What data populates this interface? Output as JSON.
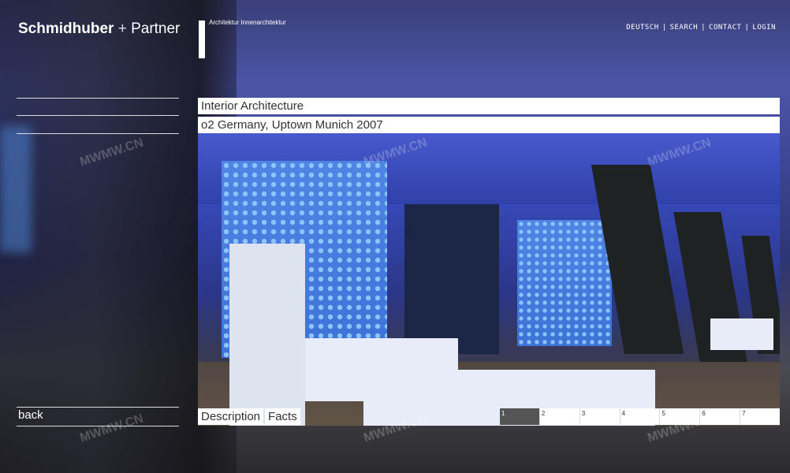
{
  "header": {
    "logo_main": "Schmidhuber",
    "logo_plus": "+",
    "logo_partner": "Partner",
    "tagline": "Architektur  Innenarchitektur",
    "nav": [
      "DEUTSCH",
      "SEARCH",
      "CONTACT",
      "LOGIN"
    ]
  },
  "project": {
    "category": "Interior Architecture",
    "title": "o2 Germany, Uptown Munich 2007"
  },
  "footer": {
    "back_label": "back",
    "tabs": [
      "Description",
      "Facts"
    ],
    "pages": [
      "1",
      "2",
      "3",
      "4",
      "5",
      "6",
      "7"
    ],
    "active_page": "1"
  },
  "watermark_text": "MWMW.CN",
  "colors": {
    "bar_bg": "#ffffff",
    "text_dark": "#333333",
    "active_page_bg": "#555555"
  }
}
